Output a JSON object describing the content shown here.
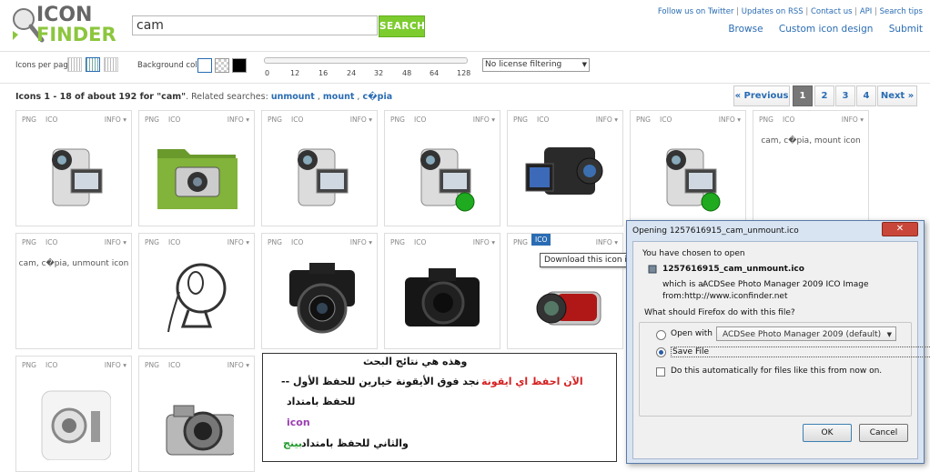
{
  "header": {
    "logo_top": "ICON",
    "logo_bottom": "FINDER",
    "search_value": "cam",
    "search_button": "SEARCH",
    "toplinks": [
      "Follow us on Twitter",
      "Updates on RSS",
      "Contact us",
      "API",
      "Search tips"
    ],
    "nav": [
      "Browse",
      "Custom icon design",
      "Submit"
    ]
  },
  "options": {
    "icons_per_page_label": "Icons per page",
    "background_color_label": "Background color",
    "size_ticks": [
      "0",
      "12",
      "16",
      "24",
      "32",
      "48",
      "64",
      "128"
    ],
    "license_filter": "No license filtering"
  },
  "results": {
    "prefix": "Icons 1 - 18 of about 192 for ",
    "query": "\"cam\"",
    "related_label": ". Related searches:",
    "related": [
      "unmount",
      "mount",
      "c�pia"
    ]
  },
  "pager": {
    "prev": "« Previous",
    "pages": [
      "1",
      "2",
      "3",
      "4"
    ],
    "next": "Next »"
  },
  "tile": {
    "png": "PNG",
    "ico": "ICO",
    "info": "INFO ▾"
  },
  "tile_texts": {
    "t7": "cam, c�pia, mount icon",
    "t8": "cam, c�pia, unmount icon"
  },
  "icons": {
    "t1": "camcorder-icon",
    "t2": "folder-camera-icon",
    "t3": "camcorder-icon",
    "t4": "camcorder-mount-icon",
    "t5": "video-camera-icon",
    "t6": "camcorder-mount-icon",
    "t9": "webcam-icon",
    "t10": "dslr-camera-icon",
    "t11": "dslr-camera-icon",
    "t12": "red-camcorder-icon",
    "t15": "camera-app-icon",
    "t16": "silver-camera-icon"
  },
  "tooltip": "Download this icon in ICO-format.",
  "annotation": {
    "line1": "وهذه  هي  نتائج البحث",
    "line2a": "الآن احفظ اي ايقونة",
    "line2b": "--  نجد فوق الأيقونة خيارين للحفظ  الأول",
    "line3": "للحفظ بامتداد",
    "line4": "icon",
    "line5a": "والثاني للحفظ بامتداد",
    "line5b": "بينج"
  },
  "dialog": {
    "title": "Opening 1257616915_cam_unmount.ico",
    "close": "✕",
    "chosen": "You have chosen to open",
    "filename": "1257616915_cam_unmount.ico",
    "which_label": "which is a:",
    "which_value": "ACDSee Photo Manager 2009 ICO Image",
    "from_label": "from:",
    "from_value": "http://www.iconfinder.net",
    "question": "What should Firefox do with this file?",
    "open_with": "Open with",
    "open_with_app": "ACDSee Photo Manager 2009 (default)",
    "save_file": "Save File",
    "auto": "Do this automatically for files like this from now on.",
    "ok": "OK",
    "cancel": "Cancel"
  },
  "colors": {
    "accent": "#2a6cb3",
    "search_btn": "#7ccc2f",
    "dialog_frame": "#d9e4f2",
    "annotation_red": "#d42020",
    "annotation_purple": "#9a3fb0",
    "annotation_green": "#1f9a2a"
  }
}
